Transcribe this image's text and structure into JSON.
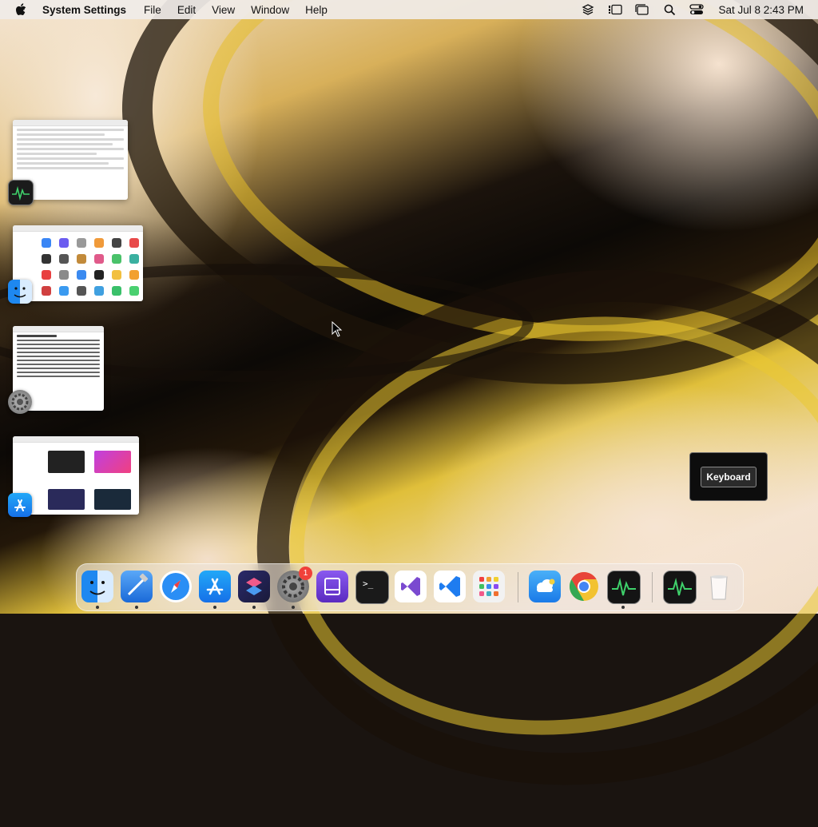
{
  "menubar": {
    "app_name": "System Settings",
    "menus": [
      "File",
      "Edit",
      "View",
      "Window",
      "Help"
    ],
    "clock": "Sat Jul 8  2:43 PM",
    "status_icons": [
      "stack-icon",
      "stage-manager-icon",
      "window-icon",
      "spotlight-icon",
      "control-center-icon"
    ]
  },
  "hud": {
    "label": "Keyboard"
  },
  "stage_manager": {
    "windows": [
      "activity-monitor-window",
      "finder-window",
      "system-settings-window",
      "app-store-window"
    ]
  },
  "dock": {
    "apps": [
      "finder",
      "xcode",
      "safari",
      "app-store",
      "shortcuts",
      "system-settings",
      "apple-configurator",
      "terminal",
      "visual-studio",
      "vscode",
      "launchpad",
      "icloud",
      "chrome",
      "activity-monitor",
      "activity-monitor-recent",
      "trash"
    ],
    "system_settings_badge": "1"
  },
  "colors": {
    "accent": "#1e7cf0",
    "badge": "#f0413a"
  }
}
